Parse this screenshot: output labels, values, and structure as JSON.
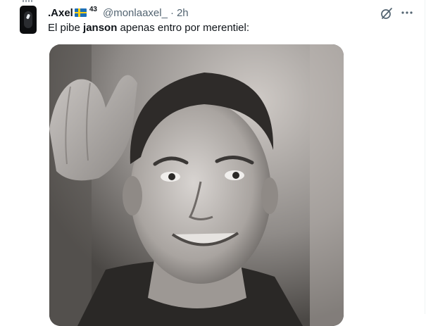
{
  "tweet": {
    "display_name": ".Axel",
    "flag_icon": "sweden-flag-icon",
    "badge_number": "43",
    "handle": "@monlaaxel_",
    "separator": "·",
    "time": "2h",
    "text_before": "El pibe ",
    "text_bold": "janson",
    "text_after": " apenas entro por merentiel:",
    "media": {
      "type": "image",
      "description_icon": "photo-grayscale"
    }
  },
  "colors": {
    "text_primary": "#0f1419",
    "text_secondary": "#536471",
    "divider": "#eff3f4",
    "flag_blue": "#1c6fb8",
    "flag_yellow": "#fcd116"
  },
  "icons": {
    "grok": "grok-icon",
    "more": "more-icon"
  }
}
